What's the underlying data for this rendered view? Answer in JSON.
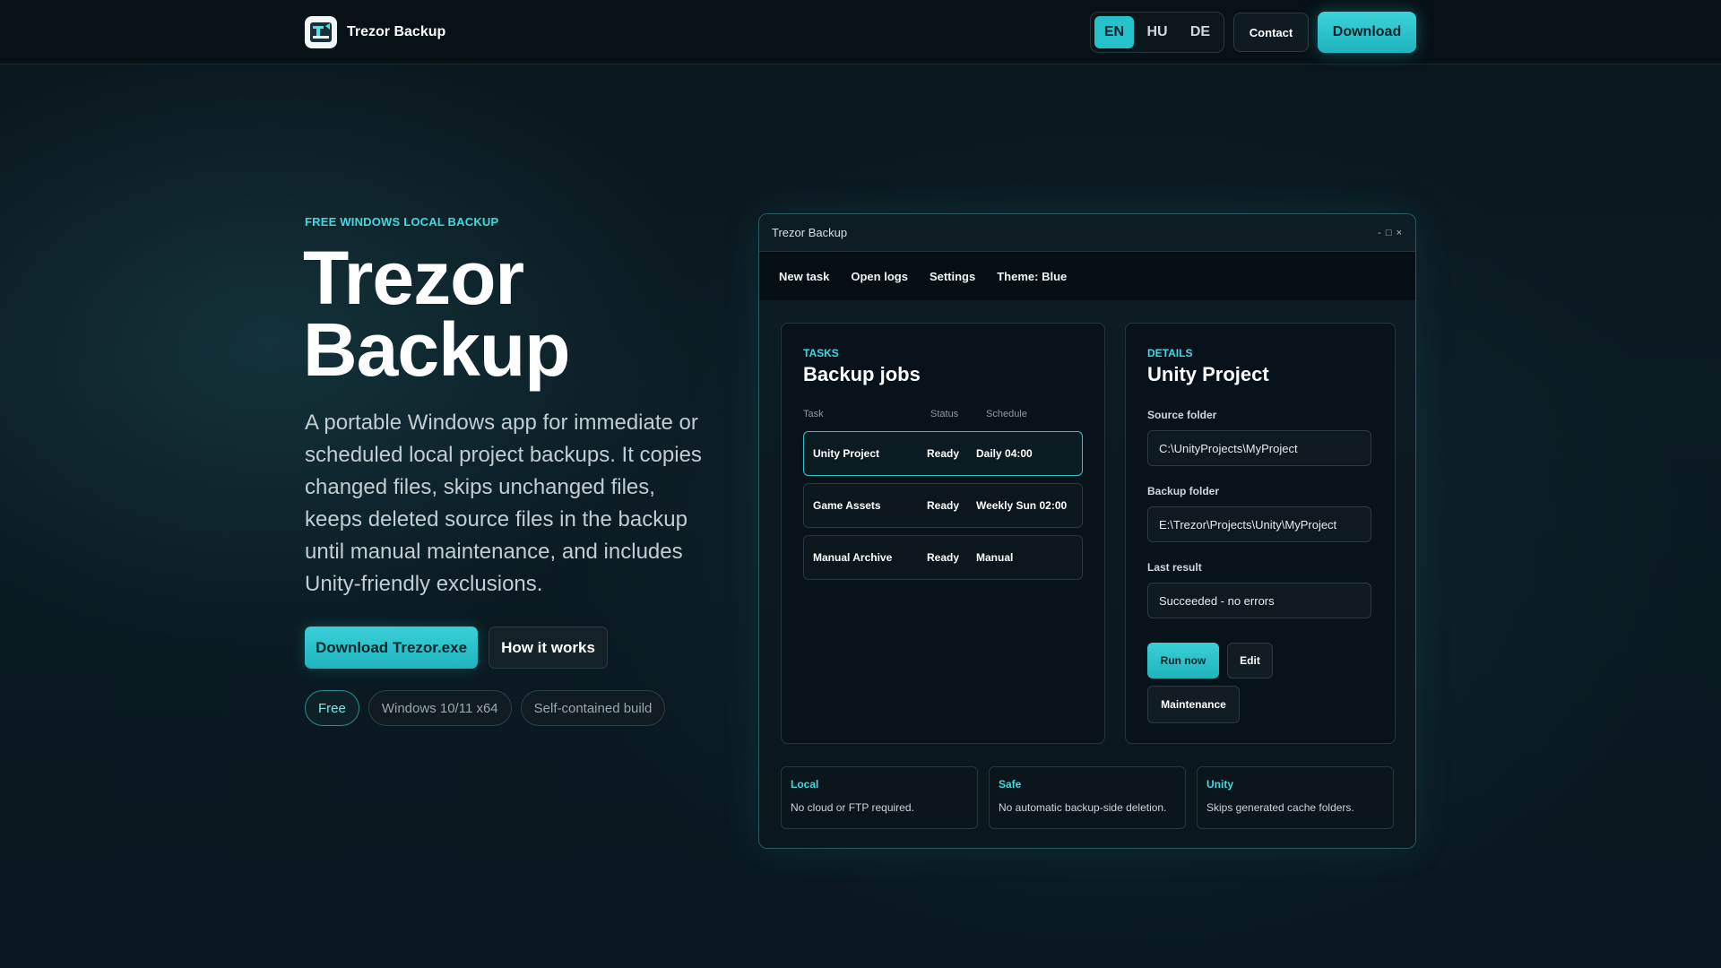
{
  "header": {
    "brand_name": "Trezor Backup",
    "languages": [
      {
        "code": "EN",
        "active": true
      },
      {
        "code": "HU",
        "active": false
      },
      {
        "code": "DE",
        "active": false
      }
    ],
    "contact_label": "Contact",
    "download_label": "Download"
  },
  "hero": {
    "eyebrow": "FREE WINDOWS LOCAL BACKUP",
    "title": "Trezor Backup",
    "description": "A portable Windows app for immediate or scheduled local project backups. It copies changed files, skips unchanged files, keeps deleted source files in the backup until manual maintenance, and includes Unity-friendly exclusions.",
    "primary_cta": "Download Trezor.exe",
    "secondary_cta": "How it works",
    "tags": [
      "Free",
      "Windows 10/11 x64",
      "Self-contained build"
    ]
  },
  "app_window": {
    "title": "Trezor Backup",
    "controls": "- □ ×",
    "menu": [
      "New task",
      "Open logs",
      "Settings",
      "Theme: Blue"
    ],
    "tasks_panel": {
      "eyebrow": "TASKS",
      "heading": "Backup jobs",
      "columns": [
        "Task",
        "Status",
        "Schedule"
      ],
      "rows": [
        {
          "task": "Unity Project",
          "status": "Ready",
          "schedule": "Daily 04:00",
          "selected": true
        },
        {
          "task": "Game Assets",
          "status": "Ready",
          "schedule": "Weekly Sun 02:00",
          "selected": false
        },
        {
          "task": "Manual Archive",
          "status": "Ready",
          "schedule": "Manual",
          "selected": false
        }
      ]
    },
    "details_panel": {
      "eyebrow": "DETAILS",
      "heading": "Unity Project",
      "source_label": "Source folder",
      "source_value": "C:\\UnityProjects\\MyProject",
      "backup_label": "Backup folder",
      "backup_value": "E:\\Trezor\\Projects\\Unity\\MyProject",
      "result_label": "Last result",
      "result_value": "Succeeded - no errors",
      "run_label": "Run now",
      "edit_label": "Edit",
      "maintenance_label": "Maintenance"
    },
    "features": [
      {
        "title": "Local",
        "text": "No cloud or FTP required."
      },
      {
        "title": "Safe",
        "text": "No automatic backup-side deletion."
      },
      {
        "title": "Unity",
        "text": "Skips generated cache folders."
      }
    ]
  },
  "colors": {
    "accent": "#25c2cc",
    "accent_text": "#3fd9e3",
    "background": "#0a161c"
  }
}
